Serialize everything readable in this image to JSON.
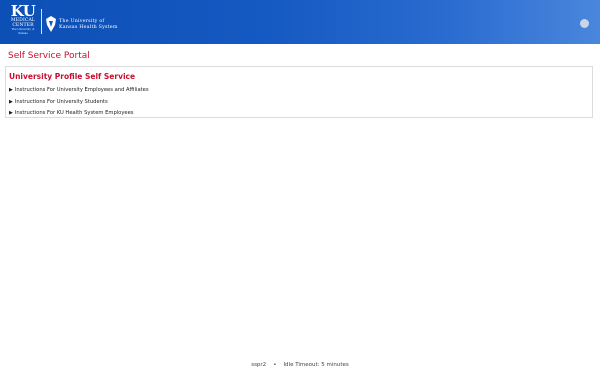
{
  "header": {
    "logo": {
      "ku": "KU",
      "medical": "MEDICAL",
      "center": "CENTER",
      "university_small": "The University of Kansas",
      "system_line1": "The University of",
      "system_line2": "Kansas Health System"
    },
    "user_icon": "user-menu-icon"
  },
  "page": {
    "title": "Self Service Portal"
  },
  "panel": {
    "title": "University Profile Self Service",
    "items": [
      {
        "label": "Instructions For University Employees and Affiliates"
      },
      {
        "label": "Instructions For University Students"
      },
      {
        "label": "Instructions For KU Health System Employees"
      }
    ]
  },
  "footer": {
    "server": "sspr2",
    "separator": "•",
    "idle_timeout": "Idle Timeout: 5 minutes"
  },
  "colors": {
    "header_start": "#0c4fb5",
    "header_end": "#4a86dc",
    "accent_red": "#c8102e"
  }
}
